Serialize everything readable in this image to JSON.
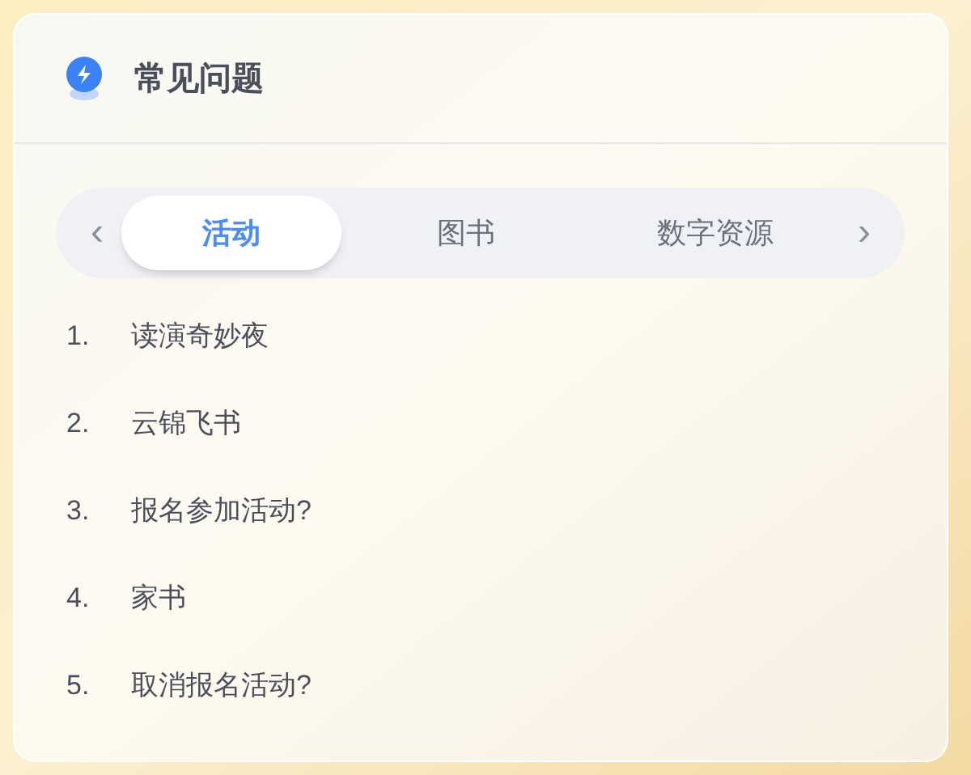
{
  "title": "常见问题",
  "tabs": [
    {
      "label": "活动",
      "selected": true
    },
    {
      "label": "图书",
      "selected": false
    },
    {
      "label": "数字资源",
      "selected": false
    }
  ],
  "prev": "‹",
  "next": "›",
  "questions": [
    {
      "number": "1.",
      "text": "读演奇妙夜"
    },
    {
      "number": "2.",
      "text": "云锦飞书"
    },
    {
      "number": "3.",
      "text": "报名参加活动?"
    },
    {
      "number": "4.",
      "text": "家书"
    },
    {
      "number": "5.",
      "text": "取消报名活动?"
    }
  ]
}
